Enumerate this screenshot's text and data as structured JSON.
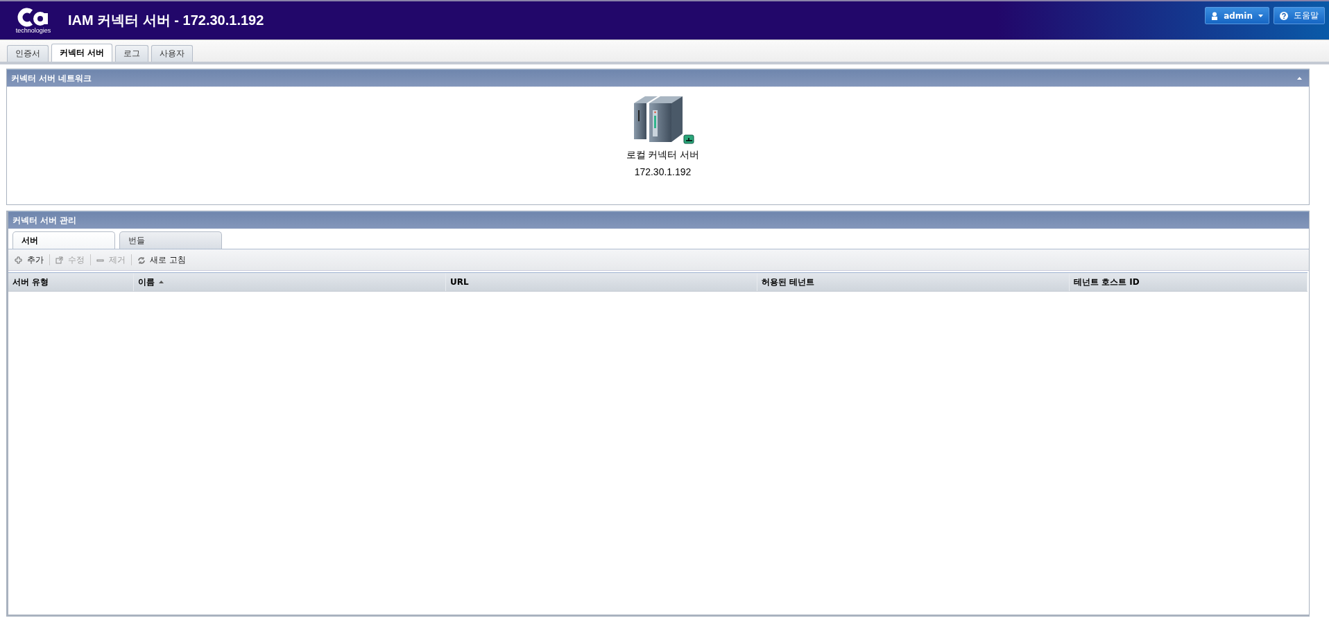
{
  "header": {
    "logo_text": "technologies",
    "title": "IAM 커넥터 서버 - 172.30.1.192",
    "user_button": "admin",
    "help_button": "도움말"
  },
  "tabs": [
    {
      "label": "인증서",
      "selected": false
    },
    {
      "label": "커넥터 서버",
      "selected": true
    },
    {
      "label": "로그",
      "selected": false
    },
    {
      "label": "사용자",
      "selected": false
    }
  ],
  "network_panel": {
    "title": "커넥터 서버 네트워크",
    "expanded": true,
    "node": {
      "name": "로컬 커넥터 서버",
      "address": "172.30.1.192"
    }
  },
  "management_panel": {
    "title": "커넥터 서버 관리",
    "tabs": [
      {
        "label": "서버",
        "selected": true
      },
      {
        "label": "번들",
        "selected": false
      }
    ],
    "toolbar": [
      {
        "kind": "add",
        "label": "추가",
        "disabled": false
      },
      {
        "kind": "edit",
        "label": "수정",
        "disabled": true
      },
      {
        "kind": "remove",
        "label": "제거",
        "disabled": true
      },
      {
        "kind": "refresh",
        "label": "새로 고침",
        "disabled": false
      }
    ],
    "table": {
      "columns": [
        {
          "label": "서버 유형",
          "sorted": false
        },
        {
          "label": "이름",
          "sorted": true
        },
        {
          "label": "URL",
          "sorted": false
        },
        {
          "label": "허용된 테넌트",
          "sorted": false
        },
        {
          "label": "테넌트 호스트 ID",
          "sorted": false
        }
      ]
    }
  }
}
